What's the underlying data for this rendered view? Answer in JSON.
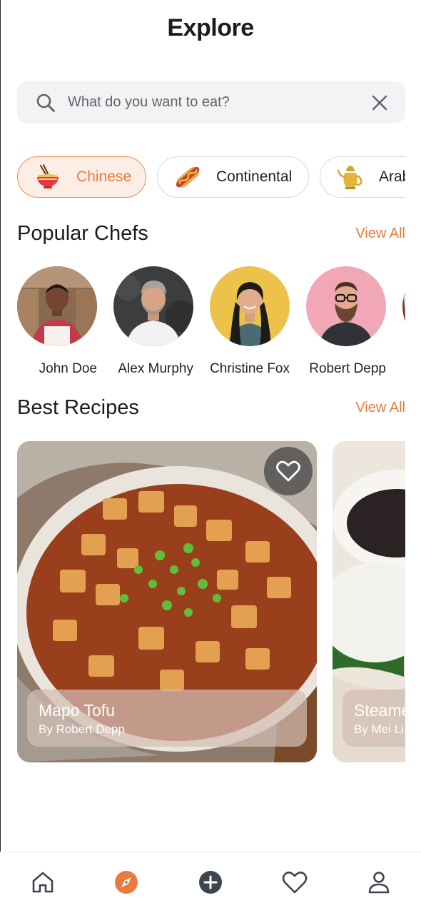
{
  "header": {
    "title": "Explore"
  },
  "search": {
    "placeholder": "What do you want to eat?",
    "value": ""
  },
  "categories": [
    {
      "label": "Chinese",
      "icon": "noodle-bowl-icon",
      "active": true
    },
    {
      "label": "Continental",
      "icon": "hotdog-icon",
      "active": false
    },
    {
      "label": "Arab",
      "icon": "teapot-icon",
      "active": false
    }
  ],
  "popular_chefs": {
    "title": "Popular Chefs",
    "view_all": "View All",
    "items": [
      {
        "name": "John Doe"
      },
      {
        "name": "Alex Murphy"
      },
      {
        "name": "Christine Fox"
      },
      {
        "name": "Robert Depp"
      }
    ]
  },
  "best_recipes": {
    "title": "Best Recipes",
    "view_all": "View All",
    "items": [
      {
        "name": "Mapo Tofu",
        "author": "By Robert Depp"
      },
      {
        "name": "Steame",
        "author": "By Mei Li"
      }
    ]
  },
  "bottom_nav": [
    "home-icon",
    "explore-compass-icon",
    "add-icon",
    "favorites-heart-icon",
    "profile-icon"
  ],
  "colors": {
    "accent": "#ec7a3d",
    "chip_active_bg": "#fdeee5",
    "text": "#1c1c1c"
  }
}
